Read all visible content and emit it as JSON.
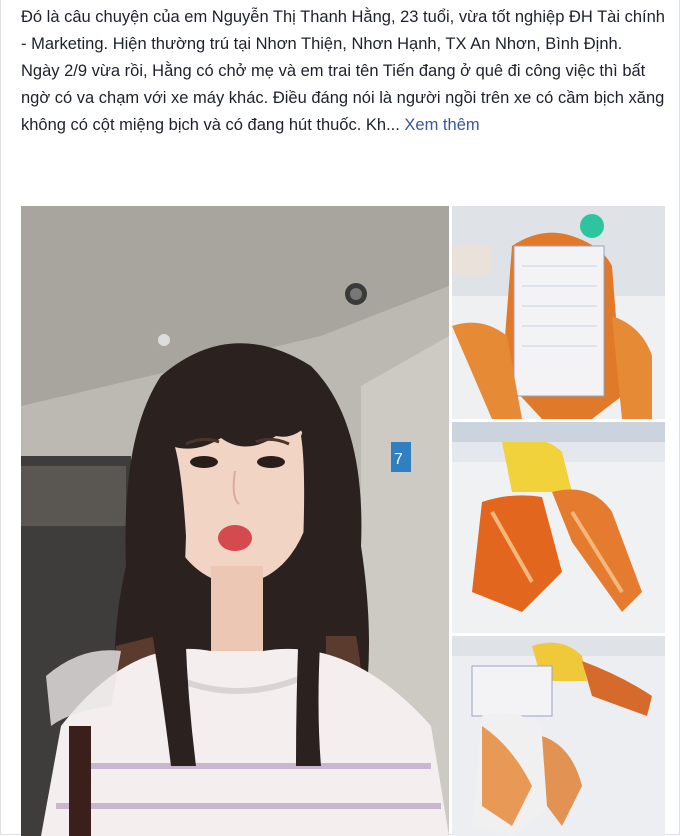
{
  "post": {
    "paragraph1": "Đó là câu chuyện của em Nguyễn Thị Thanh Hằng, 23 tuổi, vừa tốt nghiệp ĐH Tài chính - Marketing. Hiện thường trú tại Nhơn Thiện, Nhơn Hạnh, TX An Nhơn, Bình Định.",
    "paragraph2": "Ngày 2/9 vừa rồi, Hằng có chở mẹ và em trai tên Tiến đang ở quê đi công việc thì bất ngờ có va chạm với xe máy khác. Điều đáng nói là người ngồi trên xe có cầm bịch xăng không có cột miệng bịch và có đang hút thuốc. Kh...",
    "see_more": "Xem thêm"
  },
  "photos": {
    "main_sign": "7"
  },
  "colors": {
    "text": "#1d2129",
    "link": "#385898"
  }
}
